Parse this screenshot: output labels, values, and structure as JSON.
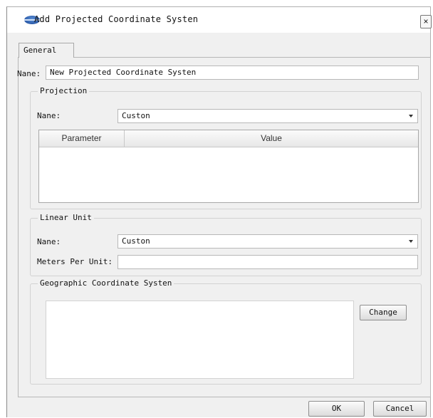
{
  "dialog": {
    "title": "Add Projected Coordinate Systen",
    "close_glyph": "×"
  },
  "tabs": [
    {
      "label": "General"
    }
  ],
  "general": {
    "name_label": "Nane:",
    "name_value": "New Projected Coordinate Systen",
    "projection": {
      "legend": "Projection",
      "name_label": "Nane:",
      "name_value": "Custon",
      "columns": [
        "Parameter",
        "Value"
      ],
      "rows": []
    },
    "linear_unit": {
      "legend": "Linear Unit",
      "name_label": "Nane:",
      "name_value": "Custon",
      "meters_label": "Meters Per Unit:",
      "meters_value": ""
    },
    "gcs": {
      "legend": "Geographic Coordinate Systen",
      "value": "",
      "change_label": "Change"
    }
  },
  "footer": {
    "ok_label": "OK",
    "cancel_label": "Cancel"
  },
  "icons": {
    "app_logo": "app-logo-icon",
    "close": "close-icon",
    "dropdown": "chevron-down-icon"
  }
}
